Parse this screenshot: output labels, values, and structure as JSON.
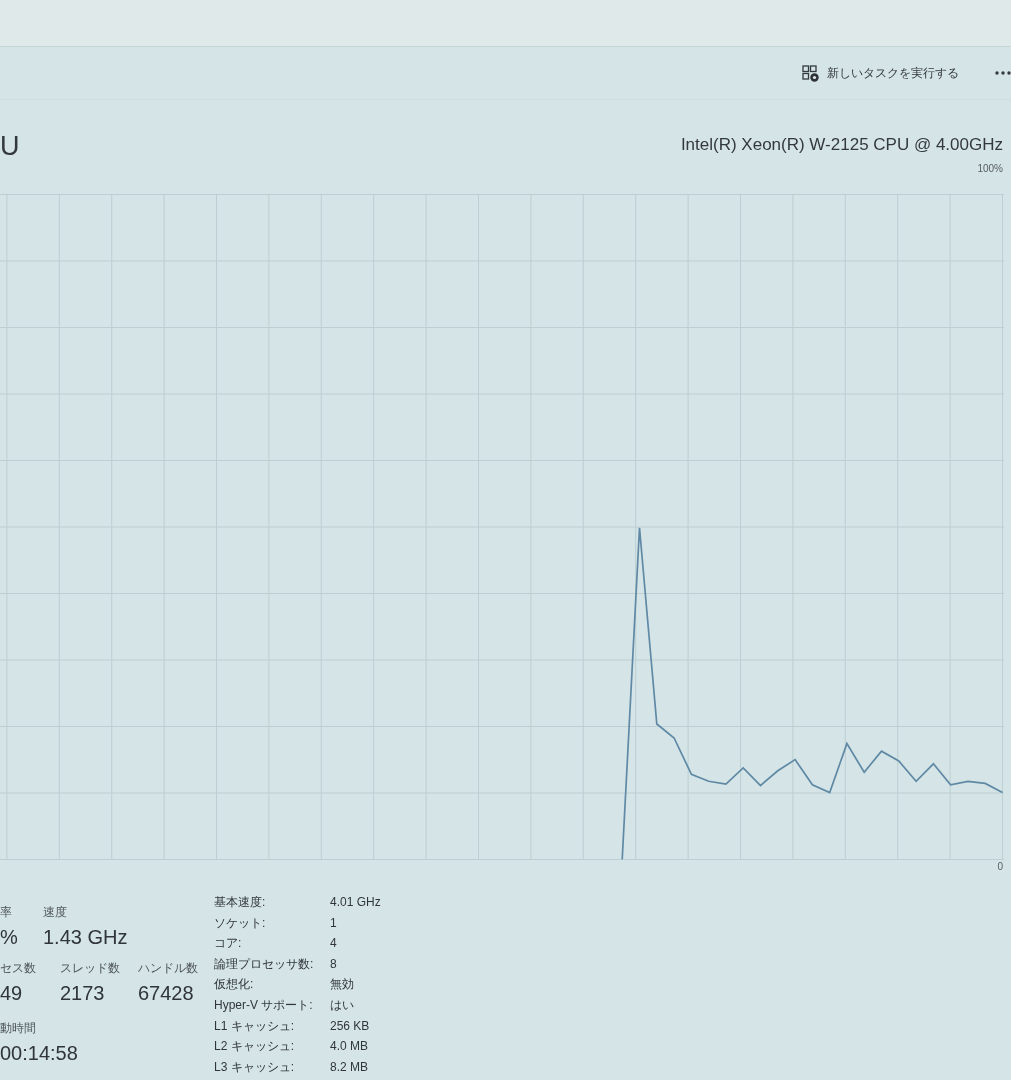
{
  "toolbar": {
    "run_task_label": "新しいタスクを実行する"
  },
  "header": {
    "title": "U",
    "cpu_name": "Intel(R) Xeon(R) W-2125 CPU @ 4.00GHz"
  },
  "graph": {
    "chart_data": {
      "type": "line",
      "grid": true,
      "categories": [
        null,
        null,
        null,
        null,
        null,
        null,
        null,
        null,
        null,
        null,
        null,
        null,
        null,
        null,
        null,
        null,
        null,
        null,
        null,
        null,
        null,
        null,
        null,
        null,
        null,
        null,
        null,
        null,
        null,
        null,
        null,
        null,
        null,
        null,
        null,
        null,
        null,
        null,
        null,
        null,
        null,
        null,
        null,
        null,
        null,
        null,
        null,
        null,
        null,
        null,
        null,
        null,
        null,
        null,
        null,
        null,
        null,
        null,
        null
      ],
      "ylim": [
        0,
        100
      ],
      "yticks": [
        {
          "value": 0,
          "label": "0"
        },
        {
          "value": 100,
          "label": "100%"
        }
      ],
      "series": [
        {
          "color": "#5f89a5",
          "values": [
            null,
            null,
            null,
            null,
            null,
            null,
            null,
            null,
            null,
            null,
            null,
            null,
            null,
            null,
            null,
            null,
            null,
            null,
            null,
            null,
            null,
            null,
            null,
            null,
            null,
            null,
            null,
            null,
            null,
            null,
            null,
            null,
            null,
            null,
            null,
            null,
            1.0,
            48.5,
            20.4,
            18.4,
            13.2,
            12.2,
            11.8,
            14.1,
            11.6,
            13.7,
            15.3,
            11.7,
            10.6,
            17.6,
            13.5,
            16.5,
            15.1,
            12.2,
            14.7,
            11.7,
            12.2,
            11.9,
            10.6
          ]
        }
      ]
    }
  },
  "stats": [
    {
      "items": [
        {
          "label": "率",
          "value": "%"
        },
        {
          "label": "速度",
          "value": "1.43 GHz"
        }
      ]
    },
    {
      "items": [
        {
          "label": "セス数",
          "value": "49"
        },
        {
          "label": "スレッド数",
          "value": "2173"
        },
        {
          "label": "ハンドル数",
          "value": "67428"
        }
      ]
    },
    {
      "items": [
        {
          "label": "動時間",
          "value": "00:14:58"
        }
      ]
    }
  ],
  "details": [
    {
      "label": "基本速度:",
      "value": "4.01 GHz"
    },
    {
      "label": "ソケット:",
      "value": "1"
    },
    {
      "label": "コア:",
      "value": "4"
    },
    {
      "label": "論理プロセッサ数:",
      "value": "8"
    },
    {
      "label": "仮想化:",
      "value": "無効"
    },
    {
      "label": "Hyper-V サポート:",
      "value": "はい"
    },
    {
      "label": "L1 キャッシュ:",
      "value": "256 KB"
    },
    {
      "label": "L2 キャッシュ:",
      "value": "4.0 MB"
    },
    {
      "label": "L3 キャッシュ:",
      "value": "8.2 MB"
    }
  ]
}
